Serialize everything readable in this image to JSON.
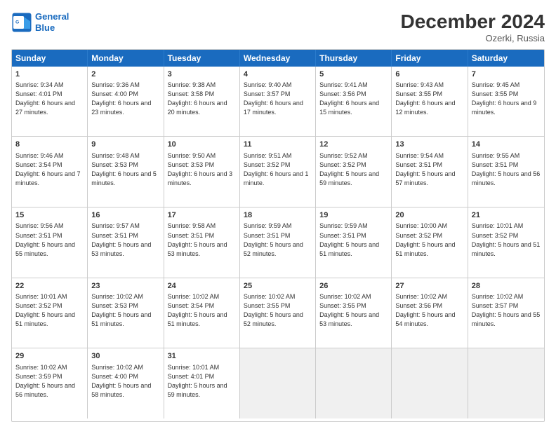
{
  "header": {
    "logo_line1": "General",
    "logo_line2": "Blue",
    "title": "December 2024",
    "subtitle": "Ozerki, Russia"
  },
  "days_of_week": [
    "Sunday",
    "Monday",
    "Tuesday",
    "Wednesday",
    "Thursday",
    "Friday",
    "Saturday"
  ],
  "weeks": [
    [
      {
        "day": "1",
        "sunrise": "Sunrise: 9:34 AM",
        "sunset": "Sunset: 4:01 PM",
        "daylight": "Daylight: 6 hours and 27 minutes."
      },
      {
        "day": "2",
        "sunrise": "Sunrise: 9:36 AM",
        "sunset": "Sunset: 4:00 PM",
        "daylight": "Daylight: 6 hours and 23 minutes."
      },
      {
        "day": "3",
        "sunrise": "Sunrise: 9:38 AM",
        "sunset": "Sunset: 3:58 PM",
        "daylight": "Daylight: 6 hours and 20 minutes."
      },
      {
        "day": "4",
        "sunrise": "Sunrise: 9:40 AM",
        "sunset": "Sunset: 3:57 PM",
        "daylight": "Daylight: 6 hours and 17 minutes."
      },
      {
        "day": "5",
        "sunrise": "Sunrise: 9:41 AM",
        "sunset": "Sunset: 3:56 PM",
        "daylight": "Daylight: 6 hours and 15 minutes."
      },
      {
        "day": "6",
        "sunrise": "Sunrise: 9:43 AM",
        "sunset": "Sunset: 3:55 PM",
        "daylight": "Daylight: 6 hours and 12 minutes."
      },
      {
        "day": "7",
        "sunrise": "Sunrise: 9:45 AM",
        "sunset": "Sunset: 3:55 PM",
        "daylight": "Daylight: 6 hours and 9 minutes."
      }
    ],
    [
      {
        "day": "8",
        "sunrise": "Sunrise: 9:46 AM",
        "sunset": "Sunset: 3:54 PM",
        "daylight": "Daylight: 6 hours and 7 minutes."
      },
      {
        "day": "9",
        "sunrise": "Sunrise: 9:48 AM",
        "sunset": "Sunset: 3:53 PM",
        "daylight": "Daylight: 6 hours and 5 minutes."
      },
      {
        "day": "10",
        "sunrise": "Sunrise: 9:50 AM",
        "sunset": "Sunset: 3:53 PM",
        "daylight": "Daylight: 6 hours and 3 minutes."
      },
      {
        "day": "11",
        "sunrise": "Sunrise: 9:51 AM",
        "sunset": "Sunset: 3:52 PM",
        "daylight": "Daylight: 6 hours and 1 minute."
      },
      {
        "day": "12",
        "sunrise": "Sunrise: 9:52 AM",
        "sunset": "Sunset: 3:52 PM",
        "daylight": "Daylight: 5 hours and 59 minutes."
      },
      {
        "day": "13",
        "sunrise": "Sunrise: 9:54 AM",
        "sunset": "Sunset: 3:51 PM",
        "daylight": "Daylight: 5 hours and 57 minutes."
      },
      {
        "day": "14",
        "sunrise": "Sunrise: 9:55 AM",
        "sunset": "Sunset: 3:51 PM",
        "daylight": "Daylight: 5 hours and 56 minutes."
      }
    ],
    [
      {
        "day": "15",
        "sunrise": "Sunrise: 9:56 AM",
        "sunset": "Sunset: 3:51 PM",
        "daylight": "Daylight: 5 hours and 55 minutes."
      },
      {
        "day": "16",
        "sunrise": "Sunrise: 9:57 AM",
        "sunset": "Sunset: 3:51 PM",
        "daylight": "Daylight: 5 hours and 53 minutes."
      },
      {
        "day": "17",
        "sunrise": "Sunrise: 9:58 AM",
        "sunset": "Sunset: 3:51 PM",
        "daylight": "Daylight: 5 hours and 53 minutes."
      },
      {
        "day": "18",
        "sunrise": "Sunrise: 9:59 AM",
        "sunset": "Sunset: 3:51 PM",
        "daylight": "Daylight: 5 hours and 52 minutes."
      },
      {
        "day": "19",
        "sunrise": "Sunrise: 9:59 AM",
        "sunset": "Sunset: 3:51 PM",
        "daylight": "Daylight: 5 hours and 51 minutes."
      },
      {
        "day": "20",
        "sunrise": "Sunrise: 10:00 AM",
        "sunset": "Sunset: 3:52 PM",
        "daylight": "Daylight: 5 hours and 51 minutes."
      },
      {
        "day": "21",
        "sunrise": "Sunrise: 10:01 AM",
        "sunset": "Sunset: 3:52 PM",
        "daylight": "Daylight: 5 hours and 51 minutes."
      }
    ],
    [
      {
        "day": "22",
        "sunrise": "Sunrise: 10:01 AM",
        "sunset": "Sunset: 3:52 PM",
        "daylight": "Daylight: 5 hours and 51 minutes."
      },
      {
        "day": "23",
        "sunrise": "Sunrise: 10:02 AM",
        "sunset": "Sunset: 3:53 PM",
        "daylight": "Daylight: 5 hours and 51 minutes."
      },
      {
        "day": "24",
        "sunrise": "Sunrise: 10:02 AM",
        "sunset": "Sunset: 3:54 PM",
        "daylight": "Daylight: 5 hours and 51 minutes."
      },
      {
        "day": "25",
        "sunrise": "Sunrise: 10:02 AM",
        "sunset": "Sunset: 3:55 PM",
        "daylight": "Daylight: 5 hours and 52 minutes."
      },
      {
        "day": "26",
        "sunrise": "Sunrise: 10:02 AM",
        "sunset": "Sunset: 3:55 PM",
        "daylight": "Daylight: 5 hours and 53 minutes."
      },
      {
        "day": "27",
        "sunrise": "Sunrise: 10:02 AM",
        "sunset": "Sunset: 3:56 PM",
        "daylight": "Daylight: 5 hours and 54 minutes."
      },
      {
        "day": "28",
        "sunrise": "Sunrise: 10:02 AM",
        "sunset": "Sunset: 3:57 PM",
        "daylight": "Daylight: 5 hours and 55 minutes."
      }
    ],
    [
      {
        "day": "29",
        "sunrise": "Sunrise: 10:02 AM",
        "sunset": "Sunset: 3:59 PM",
        "daylight": "Daylight: 5 hours and 56 minutes."
      },
      {
        "day": "30",
        "sunrise": "Sunrise: 10:02 AM",
        "sunset": "Sunset: 4:00 PM",
        "daylight": "Daylight: 5 hours and 58 minutes."
      },
      {
        "day": "31",
        "sunrise": "Sunrise: 10:01 AM",
        "sunset": "Sunset: 4:01 PM",
        "daylight": "Daylight: 5 hours and 59 minutes."
      },
      null,
      null,
      null,
      null
    ]
  ]
}
